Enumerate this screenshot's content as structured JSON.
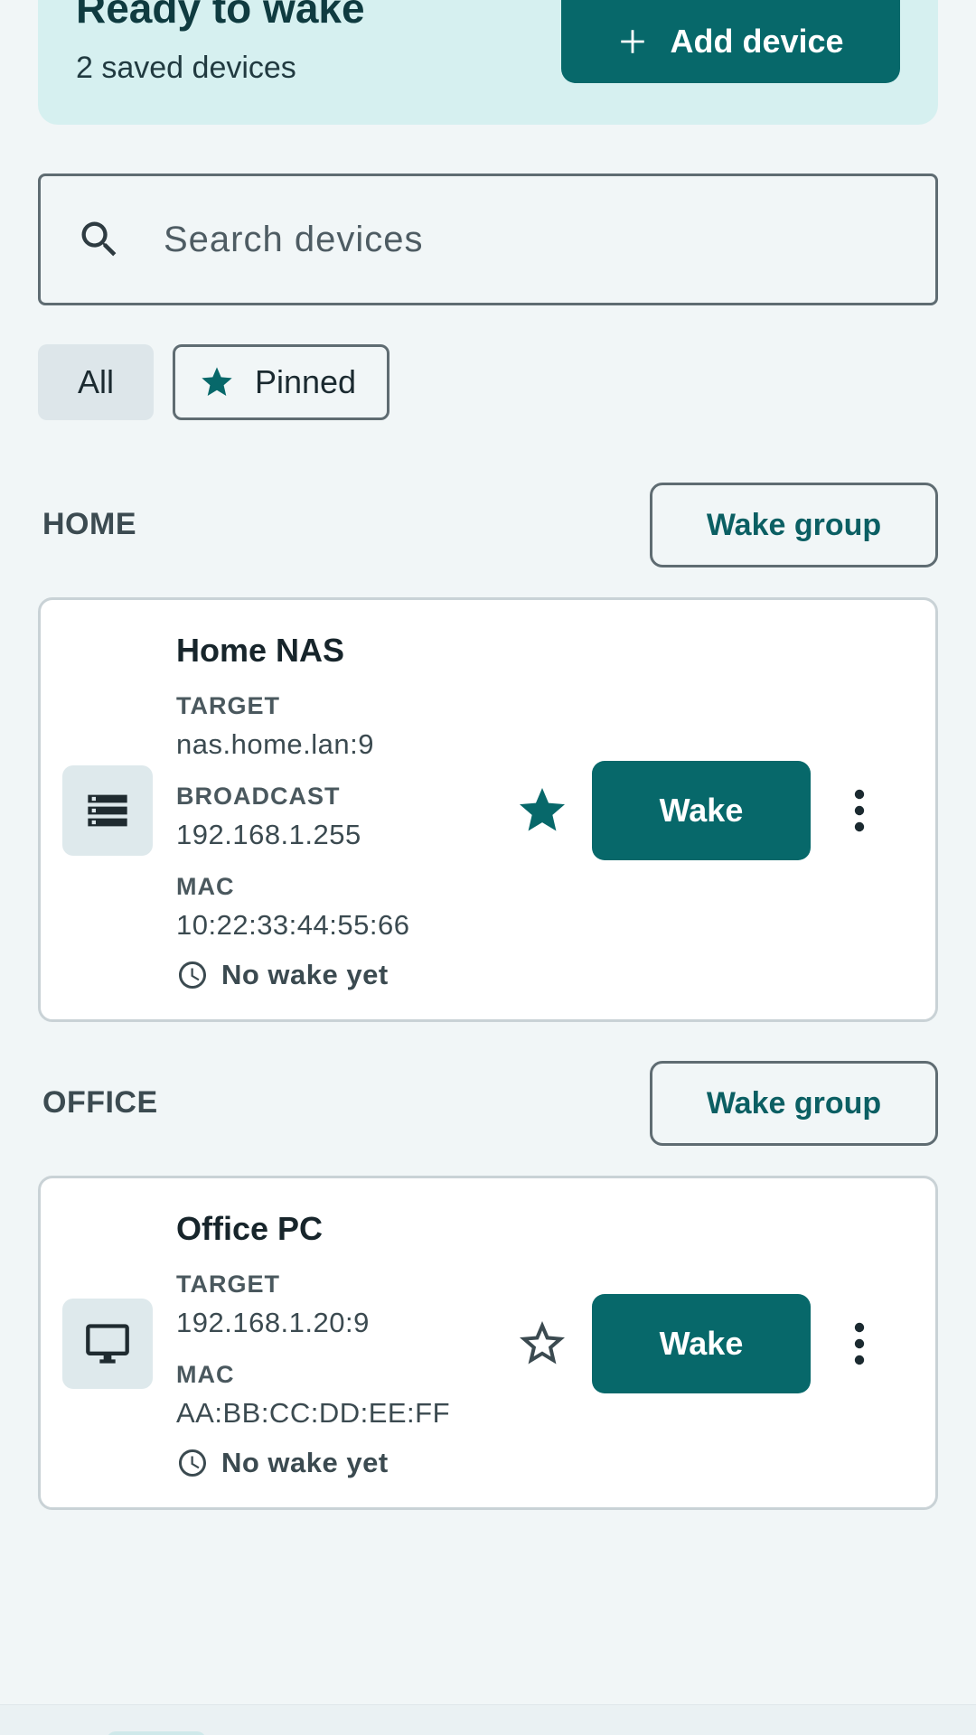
{
  "colors": {
    "accent": "#07686a",
    "background": "#f1f6f7",
    "hero_background": "#d6f0f0"
  },
  "header": {
    "title": "Ready to wake",
    "subtitle": "2 saved devices",
    "add_button_label": "Add device",
    "add_icon": "plus-icon"
  },
  "search": {
    "placeholder": "Search devices",
    "value": "",
    "icon": "search-icon"
  },
  "filters": {
    "all_label": "All",
    "pinned_label": "Pinned",
    "selected": "All"
  },
  "groups": [
    {
      "label": "HOME",
      "wake_group_label": "Wake group",
      "devices": [
        {
          "name": "Home NAS",
          "icon": "server-icon",
          "target_label": "TARGET",
          "target": "nas.home.lan:9",
          "broadcast_label": "BROADCAST",
          "broadcast": "192.168.1.255",
          "mac_label": "MAC",
          "mac": "10:22:33:44:55:66",
          "last_wake": "No wake yet",
          "pinned": true,
          "wake_label": "Wake"
        }
      ]
    },
    {
      "label": "OFFICE",
      "wake_group_label": "Wake group",
      "devices": [
        {
          "name": "Office PC",
          "icon": "desktop-icon",
          "target_label": "TARGET",
          "target": "192.168.1.20:9",
          "mac_label": "MAC",
          "mac": "AA:BB:CC:DD:EE:FF",
          "last_wake": "No wake yet",
          "pinned": false,
          "wake_label": "Wake"
        }
      ]
    }
  ]
}
